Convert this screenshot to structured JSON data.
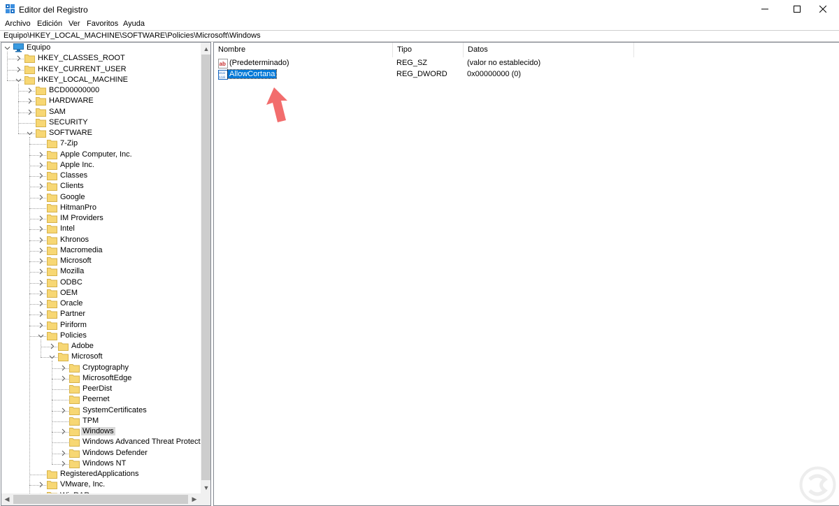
{
  "window": {
    "title": "Editor del Registro"
  },
  "menu": [
    "Archivo",
    "Edición",
    "Ver",
    "Favoritos",
    "Ayuda"
  ],
  "address": "Equipo\\HKEY_LOCAL_MACHINE\\SOFTWARE\\Policies\\Microsoft\\Windows",
  "tree": {
    "root": "Equipo",
    "items": [
      "HKEY_CLASSES_ROOT",
      "HKEY_CURRENT_USER",
      "HKEY_LOCAL_MACHINE",
      "BCD00000000",
      "HARDWARE",
      "SAM",
      "SECURITY",
      "SOFTWARE",
      "7-Zip",
      "Apple Computer, Inc.",
      "Apple Inc.",
      "Classes",
      "Clients",
      "Google",
      "HitmanPro",
      "IM Providers",
      "Intel",
      "Khronos",
      "Macromedia",
      "Microsoft",
      "Mozilla",
      "ODBC",
      "OEM",
      "Oracle",
      "Partner",
      "Piriform",
      "Policies",
      "Adobe",
      "Microsoft",
      "Cryptography",
      "MicrosoftEdge",
      "PeerDist",
      "Peernet",
      "SystemCertificates",
      "TPM",
      "Windows",
      "Windows Advanced Threat Protection",
      "Windows Defender",
      "Windows NT",
      "RegisteredApplications",
      "VMware, Inc.",
      "WinRAR"
    ]
  },
  "columns": {
    "name": "Nombre",
    "type": "Tipo",
    "data": "Datos"
  },
  "values": [
    {
      "name": "(Predeterminado)",
      "type": "REG_SZ",
      "data": "(valor no establecido)",
      "icon": "string-value-icon"
    },
    {
      "name": "AllowCortana",
      "type": "REG_DWORD",
      "data": "0x00000000 (0)",
      "icon": "dword-value-icon"
    }
  ],
  "colors": {
    "selection": "#0078d7",
    "folder": "#f7d774",
    "arrow": "#f26d6d"
  }
}
